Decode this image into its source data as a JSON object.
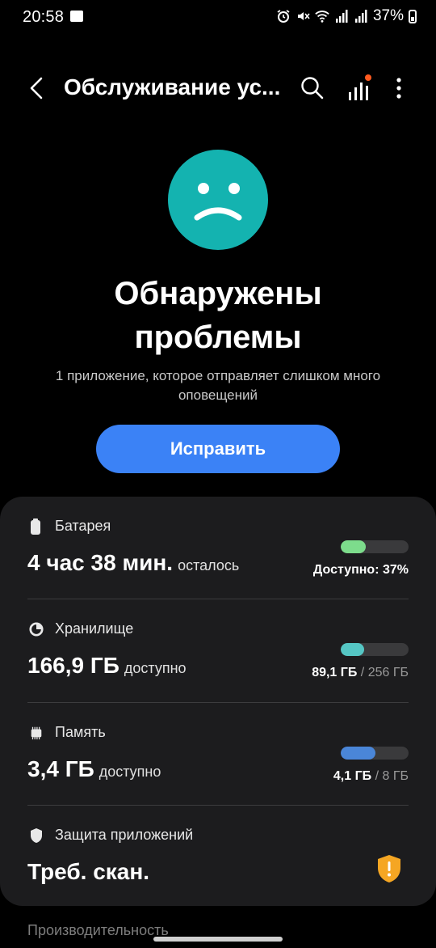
{
  "status_bar": {
    "time": "20:58",
    "battery_percent": "37%"
  },
  "app_bar": {
    "title": "Обслуживание ус..."
  },
  "hero": {
    "headline_line1": "Обнаружены",
    "headline_line2": "проблемы",
    "subtext_line1": "1 приложение, которое отправляет слишком много",
    "subtext_line2": "оповещений",
    "fix_button": "Исправить"
  },
  "battery": {
    "title": "Батарея",
    "value": "4 час 38 мин.",
    "unit": "осталось",
    "bar_label": "Доступно: 37%",
    "level": 0.37,
    "color": "#7ddc8c"
  },
  "storage": {
    "title": "Хранилище",
    "value": "166,9 ГБ",
    "unit": "доступно",
    "used": "89,1 ГБ",
    "total": "/ 256 ГБ",
    "level": 0.35,
    "color": "#55c6c4"
  },
  "memory": {
    "title": "Память",
    "value": "3,4 ГБ",
    "unit": "доступно",
    "used": "4,1 ГБ",
    "total": "/ 8 ГБ",
    "level": 0.51,
    "color": "#4a86d8"
  },
  "app_protection": {
    "title": "Защита приложений",
    "value": "Треб. скан.",
    "badge_color": "#f5a623"
  },
  "next_section": {
    "title": "Производительность"
  }
}
